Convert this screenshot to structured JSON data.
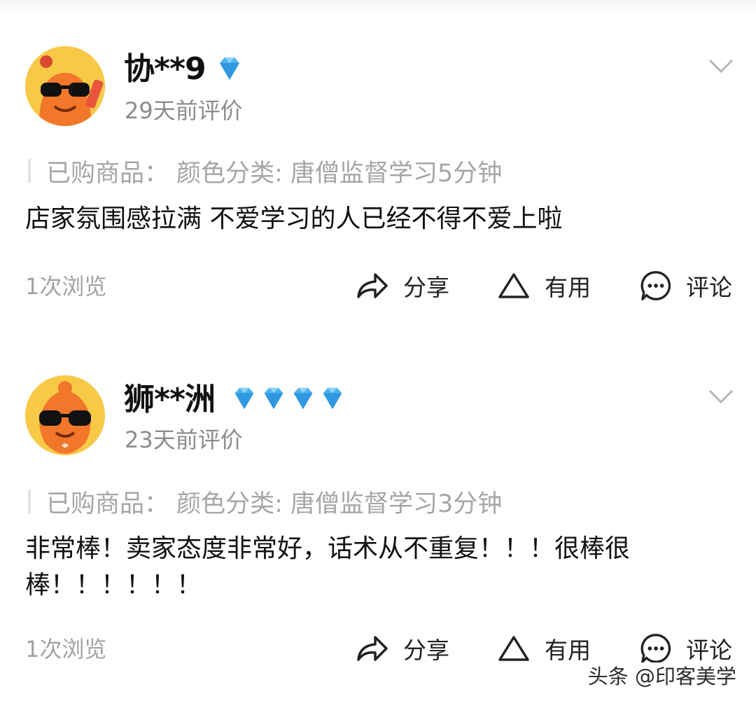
{
  "reviews": [
    {
      "username": "协**9",
      "badge_count": 1,
      "time": "29天前评价",
      "product": "已购商品：  颜色分类: 唐僧监督学习5分钟",
      "content": "店家氛围感拉满  不爱学习的人已经不得不爱上啦",
      "views": "1次浏览",
      "share_label": "分享",
      "useful_label": "有用",
      "comment_label": "评论"
    },
    {
      "username": "狮**洲",
      "badge_count": 4,
      "time": "23天前评价",
      "product": "已购商品：  颜色分类: 唐僧监督学习3分钟",
      "content": "非常棒！卖家态度非常好，话术从不重复！！！很棒很棒！！！！！！",
      "views": "1次浏览",
      "share_label": "分享",
      "useful_label": "有用",
      "comment_label": "评论"
    }
  ],
  "watermark": "头条 @印客美学",
  "icons": {
    "badge": "diamond-icon",
    "expand": "chevron-down-icon",
    "share": "share-arrow-icon",
    "useful": "triangle-icon",
    "comment": "chat-bubble-icon"
  },
  "colors": {
    "diamond": "#4fb3ef",
    "avatar_bg": "#f7c947",
    "mascot": "#f2772a",
    "muted_text": "#8c8c8c"
  }
}
